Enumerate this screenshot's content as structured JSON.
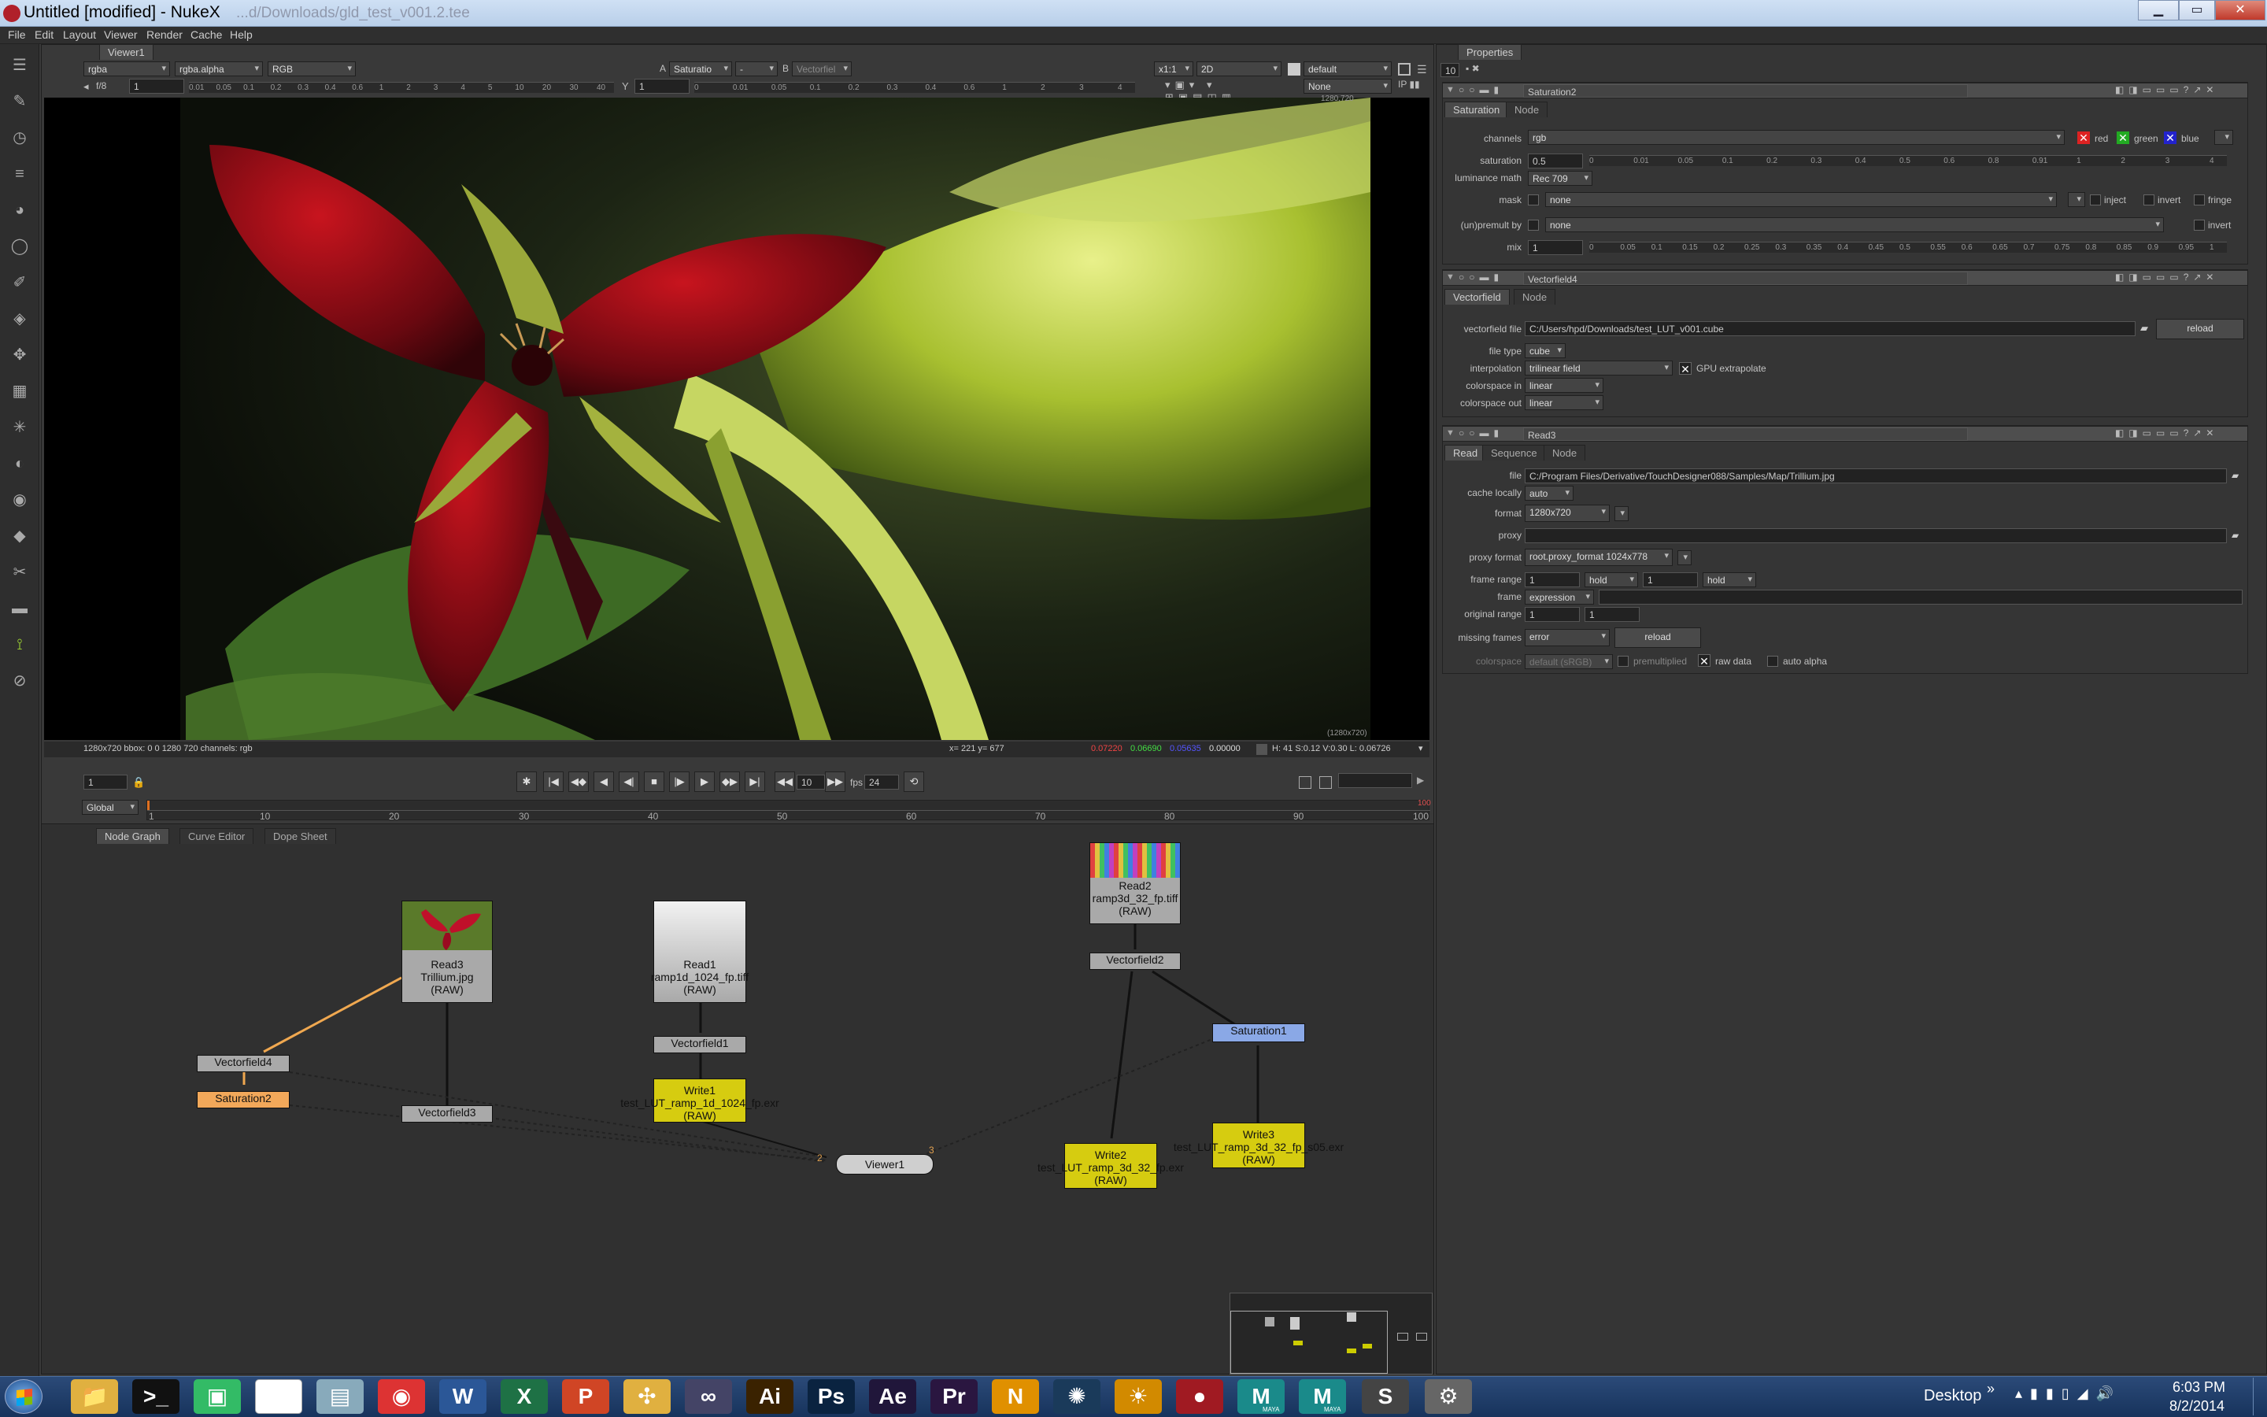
{
  "window": {
    "title": "Untitled [modified] - NukeX",
    "path_hint": "...d/Downloads/gld_test_v001.2.tee",
    "min": "▁",
    "max": "▭",
    "close": "✕"
  },
  "menu": [
    "File",
    "Edit",
    "Layout",
    "Viewer",
    "Render",
    "Cache",
    "Help"
  ],
  "viewer": {
    "tab": "Viewer1",
    "channels": "rgba",
    "alpha": "rgba.alpha",
    "colorspace": "RGB",
    "a_label": "A",
    "a_input": "Saturatio",
    "dash": "-",
    "b_label": "B",
    "b_input": "Vectorfiel",
    "zoom": "x1:1",
    "mode": "2D",
    "lut": "default",
    "fstop": "f/8",
    "frame": "1",
    "y": "1",
    "none": "None",
    "res_top": "1280,720",
    "res_bottom": "(1280x720)",
    "status_left": "1280x720 bbox: 0 0 1280 720 channels: rgb",
    "coords": "x= 221 y= 677",
    "pix_r": "0.07220",
    "pix_g": "0.06690",
    "pix_b": "0.05635",
    "pix_a": "0.00000",
    "hsvl": "H: 41 S:0.12 V:0.30  L: 0.06726",
    "gain_ticks": [
      "0.01",
      "0.05",
      "0.1",
      "0.2",
      "0.3",
      "0.4",
      "0.6",
      "1",
      "2",
      "3",
      "4",
      "5",
      "10",
      "20",
      "30",
      "40"
    ],
    "gamma_ticks": [
      "0",
      "0.01",
      "0.05",
      "0.1",
      "0.2",
      "0.3",
      "0.4",
      "0.6",
      "1",
      "2",
      "3",
      "4"
    ]
  },
  "timeline": {
    "frame": "1",
    "global": "Global",
    "ticks": [
      "1",
      "10",
      "20",
      "30",
      "40",
      "50",
      "60",
      "70",
      "80",
      "90",
      "100"
    ],
    "step": "10",
    "fps_label": "fps",
    "fps": "24",
    "end": "100"
  },
  "graph": {
    "tabs": [
      "Node Graph",
      "Curve Editor",
      "Dope Sheet"
    ],
    "nodes": {
      "read3": {
        "title": "Read3",
        "file": "Trillium.jpg",
        "mode": "(RAW)"
      },
      "read1": {
        "title": "Read1",
        "file": "ramp1d_1024_fp.tiff",
        "mode": "(RAW)"
      },
      "read2": {
        "title": "Read2",
        "file": "ramp3d_32_fp.tiff",
        "mode": "(RAW)"
      },
      "vectorfield4": "Vectorfield4",
      "saturation2": "Saturation2",
      "vectorfield3": "Vectorfield3",
      "vectorfield1": "Vectorfield1",
      "vectorfield2": "Vectorfield2",
      "saturation1": "Saturation1",
      "write1": {
        "title": "Write1",
        "file": "test_LUT_ramp_1d_1024_fp.exr",
        "mode": "(RAW)"
      },
      "write2": {
        "title": "Write2",
        "file": "test_LUT_ramp_3d_32_fp.exr",
        "mode": "(RAW)"
      },
      "write3": {
        "title": "Write3",
        "file": "test_LUT_ramp_3d_32_fp_s05.exr",
        "mode": "(RAW)"
      },
      "viewer1": "Viewer1",
      "viewer_in_a": "2",
      "viewer_in_b": "3"
    }
  },
  "properties": {
    "tab": "Properties",
    "max_panels": "10",
    "saturation": {
      "name": "Saturation2",
      "tabs": [
        "Saturation",
        "Node"
      ],
      "channels_label": "channels",
      "channels": "rgb",
      "red": "red",
      "green": "green",
      "blue": "blue",
      "saturation_label": "saturation",
      "saturation": "0.5",
      "luminance_label": "luminance math",
      "luminance": "Rec 709",
      "mask_label": "mask",
      "mask": "none",
      "inject": "inject",
      "invert": "invert",
      "fringe": "fringe",
      "premult_label": "(un)premult by",
      "premult": "none",
      "invert2": "invert",
      "mix_label": "mix",
      "mix": "1",
      "sat_ticks": [
        "0",
        "0.01",
        "0.05",
        "0.1",
        "0.2",
        "0.3",
        "0.4",
        "0.5",
        "0.6",
        "0.8",
        "0.91",
        "1",
        "2",
        "3",
        "4"
      ],
      "mix_ticks": [
        "0",
        "0.05",
        "0.1",
        "0.15",
        "0.2",
        "0.25",
        "0.3",
        "0.35",
        "0.4",
        "0.45",
        "0.5",
        "0.55",
        "0.6",
        "0.65",
        "0.7",
        "0.75",
        "0.8",
        "0.85",
        "0.9",
        "0.95",
        "1"
      ]
    },
    "vectorfield": {
      "name": "Vectorfield4",
      "tabs": [
        "Vectorfield",
        "Node"
      ],
      "file_label": "vectorfield file",
      "file": "C:/Users/hpd/Downloads/test_LUT_v001.cube",
      "reload": "reload",
      "type_label": "file type",
      "type": "cube",
      "interp_label": "interpolation",
      "interp": "trilinear field",
      "gpu": "GPU extrapolate",
      "cs_in_label": "colorspace in",
      "cs_in": "linear",
      "cs_out_label": "colorspace out",
      "cs_out": "linear"
    },
    "read": {
      "name": "Read3",
      "tabs": [
        "Read",
        "Sequence",
        "Node"
      ],
      "file_label": "file",
      "file": "C:/Program Files/Derivative/TouchDesigner088/Samples/Map/Trillium.jpg",
      "cache_label": "cache locally",
      "cache": "auto",
      "format_label": "format",
      "format": "1280x720",
      "proxy_label": "proxy",
      "proxy_format_label": "proxy format",
      "proxy_format": "root.proxy_format 1024x778",
      "range_label": "frame range",
      "range_start": "1",
      "hold1": "hold",
      "range_end": "1",
      "hold2": "hold",
      "frame_label": "frame",
      "frame": "expression",
      "orig_label": "original range",
      "orig_start": "1",
      "orig_end": "1",
      "missing_label": "missing frames",
      "missing": "error",
      "reload": "reload",
      "cs_label": "colorspace",
      "cs": "default (sRGB)",
      "premultiplied": "premultiplied",
      "raw": "raw data",
      "auto_alpha": "auto alpha"
    }
  },
  "taskbar": {
    "icons": [
      {
        "name": "explorer",
        "label": "📁",
        "color": "#e0b040"
      },
      {
        "name": "cmd",
        "label": ">_",
        "color": "#111"
      },
      {
        "name": "remote",
        "label": "▣",
        "color": "#3b6"
      },
      {
        "name": "notepad",
        "label": "",
        "color": "#fff"
      },
      {
        "name": "files",
        "label": "▤",
        "color": "#8ab"
      },
      {
        "name": "chrome",
        "label": "◉",
        "color": "#d33"
      },
      {
        "name": "word",
        "label": "W",
        "color": "#2b5797"
      },
      {
        "name": "excel",
        "label": "X",
        "color": "#1e7145"
      },
      {
        "name": "powerpoint",
        "label": "P",
        "color": "#d04525"
      },
      {
        "name": "puzzle",
        "label": "✣",
        "color": "#e0b040"
      },
      {
        "name": "swirl",
        "label": "∞",
        "color": "#446"
      },
      {
        "name": "illustrator",
        "label": "Ai",
        "color": "#3a2200"
      },
      {
        "name": "photoshop",
        "label": "Ps",
        "color": "#0a2340"
      },
      {
        "name": "aftereffects",
        "label": "Ae",
        "color": "#20163a"
      },
      {
        "name": "premiere",
        "label": "Pr",
        "color": "#2a1640"
      },
      {
        "name": "nuke-n",
        "label": "N",
        "color": "#e09000"
      },
      {
        "name": "blender",
        "label": "✺",
        "color": "#1a3a5a"
      },
      {
        "name": "sun",
        "label": "☀",
        "color": "#d28a00"
      },
      {
        "name": "nukex",
        "label": "●",
        "color": "#a01a22"
      },
      {
        "name": "maya1",
        "label": "M",
        "color": "#1a8a8a"
      },
      {
        "name": "maya2",
        "label": "M",
        "color": "#1a8a8a"
      },
      {
        "name": "sublime",
        "label": "S",
        "color": "#444"
      },
      {
        "name": "gear",
        "label": "⚙",
        "color": "#666"
      }
    ],
    "maya": "MAYA",
    "desktop": "Desktop",
    "chevron": "»",
    "time": "6:03 PM",
    "date": "8/2/2014"
  }
}
